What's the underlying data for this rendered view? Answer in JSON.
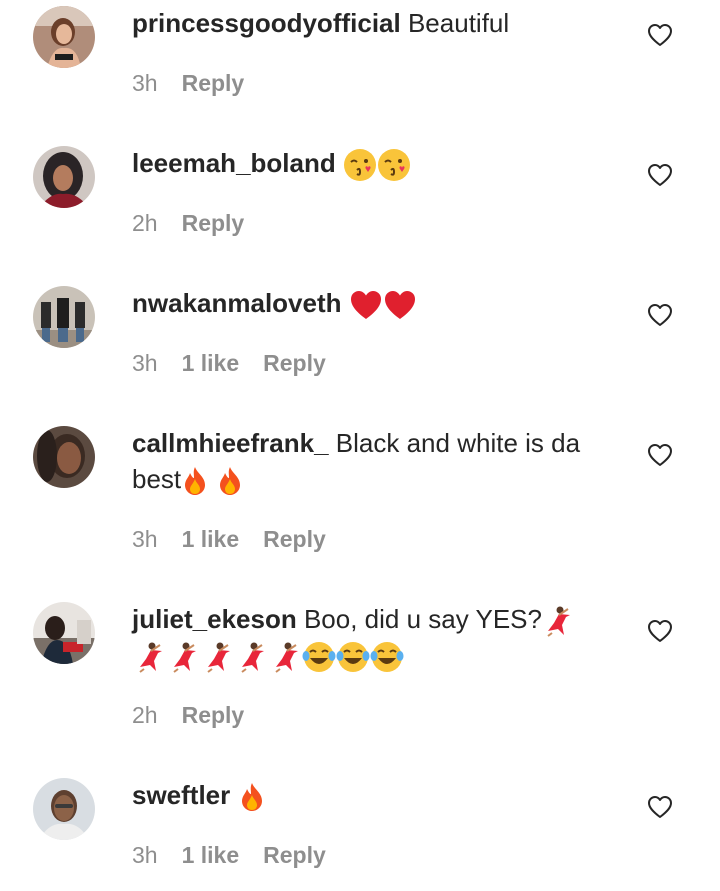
{
  "comments": [
    {
      "username": "princessgoodyofficial",
      "text": "Beautiful",
      "emojis": "",
      "time": "3h",
      "likes": "",
      "reply": "Reply"
    },
    {
      "username": "leeemah_boland",
      "text": "",
      "emojis": "😘😘",
      "time": "2h",
      "likes": "",
      "reply": "Reply"
    },
    {
      "username": "nwakanmaloveth",
      "text": "",
      "emojis": "❤️❤️",
      "time": "3h",
      "likes": "1 like",
      "reply": "Reply"
    },
    {
      "username": "callmhieefrank_",
      "text": "Black and white is da best",
      "emojis": "🔥 🔥",
      "time": "3h",
      "likes": "1 like",
      "reply": "Reply"
    },
    {
      "username": "juliet_ekeson",
      "text": "Boo, did u say YES?",
      "emojis": "💃💃💃💃💃💃😂😂😂",
      "time": "2h",
      "likes": "",
      "reply": "Reply"
    },
    {
      "username": "sweftler",
      "text": "",
      "emojis": "🔥",
      "time": "3h",
      "likes": "1 like",
      "reply": "Reply"
    }
  ],
  "icons": {
    "heart": "heart-outline-icon",
    "kiss": "face-blowing-kiss-icon",
    "red_heart": "red-heart-icon",
    "fire": "fire-icon",
    "dancer": "dancer-icon",
    "laugh": "tears-of-joy-icon"
  },
  "colors": {
    "text": "#262626",
    "meta": "#8e8e8e"
  }
}
